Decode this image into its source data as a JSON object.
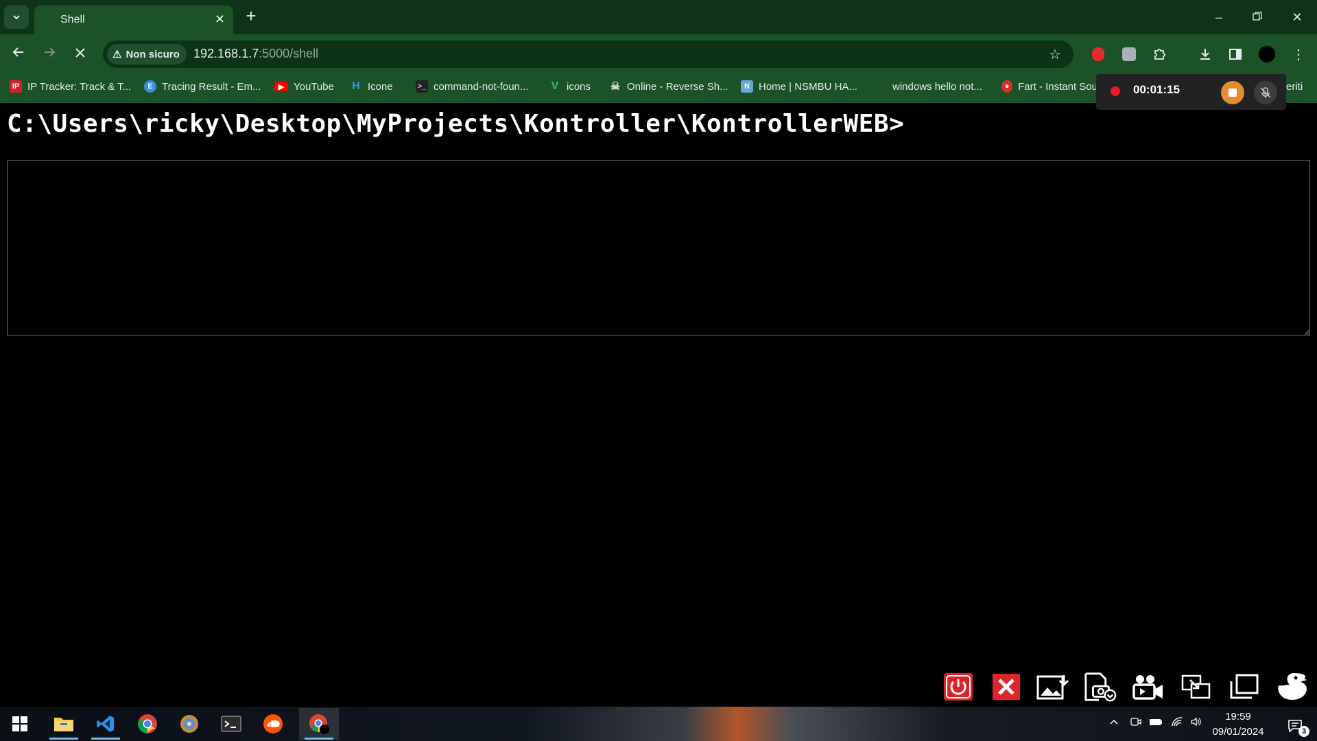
{
  "browser": {
    "tab_title": "Shell",
    "security_label": "Non sicuro",
    "url_host": "192.168.1.7",
    "url_rest": ":5000/shell"
  },
  "bookmarks": [
    {
      "label": "IP Tracker: Track & T...",
      "icon": "ip-tracker-icon"
    },
    {
      "label": "Tracing Result - Em...",
      "icon": "tracing-icon"
    },
    {
      "label": "YouTube",
      "icon": "youtube-icon"
    },
    {
      "label": "Icone",
      "icon": "icone-icon"
    },
    {
      "label": "command-not-foun...",
      "icon": "terminal-icon"
    },
    {
      "label": "icons",
      "icon": "vuetify-icon"
    },
    {
      "label": "Online - Reverse Sh...",
      "icon": "skull-icon"
    },
    {
      "label": "Home | NSMBU HA...",
      "icon": "nsmbu-icon"
    },
    {
      "label": "windows hello not...",
      "icon": "windows-icon"
    },
    {
      "label": "Fart - Instant Sou",
      "icon": "fart-icon"
    },
    {
      "label": "eriti",
      "icon": ""
    }
  ],
  "recorder": {
    "time": "00:01:15"
  },
  "page": {
    "prompt": "C:\\Users\\ricky\\Desktop\\MyProjects\\Kontroller\\KontrollerWEB>",
    "input_value": ""
  },
  "controls": [
    {
      "name": "power-button",
      "icon": "power-icon"
    },
    {
      "name": "close-button",
      "icon": "close-icon"
    },
    {
      "name": "screenshot-button",
      "icon": "image-download-icon"
    },
    {
      "name": "camera-button",
      "icon": "camera-icon"
    },
    {
      "name": "video-button",
      "icon": "video-camera-icon"
    },
    {
      "name": "screen-share-button",
      "icon": "screen-share-icon"
    },
    {
      "name": "windows-button",
      "icon": "windows-overlap-icon"
    },
    {
      "name": "duck-button",
      "icon": "duck-icon"
    }
  ],
  "taskbar": {
    "time": "19:59",
    "date": "09/01/2024",
    "notification_count": "3"
  }
}
